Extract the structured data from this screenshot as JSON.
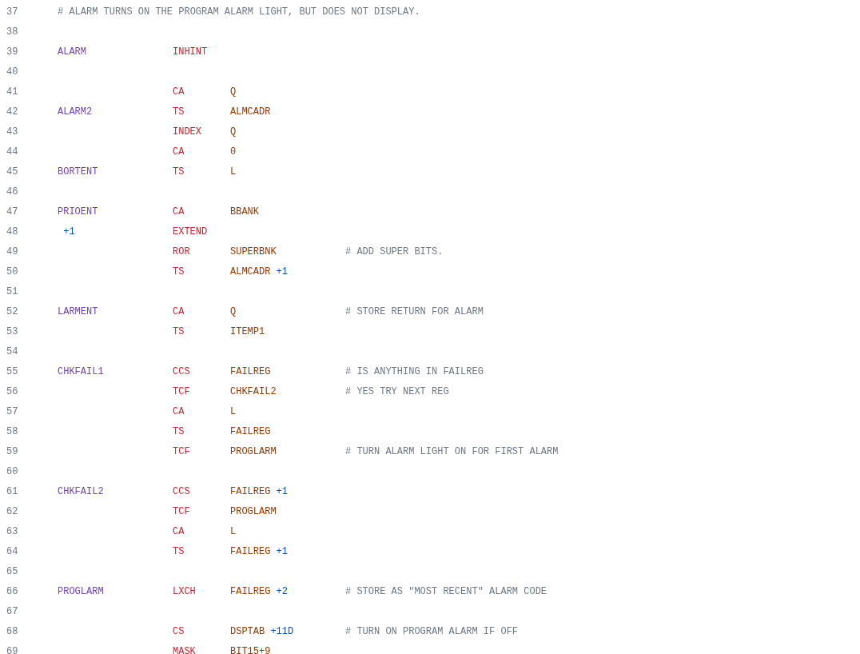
{
  "lines": [
    {
      "number": "37",
      "comment": "# ALARM TURNS ON THE PROGRAM ALARM LIGHT, BUT DOES NOT DISPLAY."
    },
    {
      "number": "38"
    },
    {
      "number": "39",
      "label": "ALARM",
      "opcode": "INHINT"
    },
    {
      "number": "40"
    },
    {
      "number": "41",
      "opcode": "CA",
      "operand": "Q"
    },
    {
      "number": "42",
      "label": "ALARM2",
      "opcode": "TS",
      "operand": "ALMCADR"
    },
    {
      "number": "43",
      "opcode": "INDEX",
      "operand": "Q"
    },
    {
      "number": "44",
      "opcode": "CA",
      "operand": "0"
    },
    {
      "number": "45",
      "label": "BORTENT",
      "opcode": "TS",
      "operand": "L"
    },
    {
      "number": "46"
    },
    {
      "number": "47",
      "label": "PRIOENT",
      "opcode": "CA",
      "operand": "BBANK"
    },
    {
      "number": "48",
      "label_offset": "+1",
      "opcode": "EXTEND"
    },
    {
      "number": "49",
      "opcode": "ROR",
      "operand": "SUPERBNK",
      "comment": "# ADD SUPER BITS."
    },
    {
      "number": "50",
      "opcode": "TS",
      "operand": "ALMCADR",
      "offset": "+1"
    },
    {
      "number": "51"
    },
    {
      "number": "52",
      "label": "LARMENT",
      "opcode": "CA",
      "operand": "Q",
      "comment": "# STORE RETURN FOR ALARM"
    },
    {
      "number": "53",
      "opcode": "TS",
      "operand": "ITEMP1"
    },
    {
      "number": "54"
    },
    {
      "number": "55",
      "label": "CHKFAIL1",
      "opcode": "CCS",
      "operand": "FAILREG",
      "comment": "# IS ANYTHING IN FAILREG"
    },
    {
      "number": "56",
      "opcode": "TCF",
      "operand": "CHKFAIL2",
      "comment": "# YES TRY NEXT REG"
    },
    {
      "number": "57",
      "opcode": "CA",
      "operand": "L"
    },
    {
      "number": "58",
      "opcode": "TS",
      "operand": "FAILREG"
    },
    {
      "number": "59",
      "opcode": "TCF",
      "operand": "PROGLARM",
      "comment": "# TURN ALARM LIGHT ON FOR FIRST ALARM"
    },
    {
      "number": "60"
    },
    {
      "number": "61",
      "label": "CHKFAIL2",
      "opcode": "CCS",
      "operand": "FAILREG",
      "offset": "+1"
    },
    {
      "number": "62",
      "opcode": "TCF",
      "operand": "PROGLARM"
    },
    {
      "number": "63",
      "opcode": "CA",
      "operand": "L"
    },
    {
      "number": "64",
      "opcode": "TS",
      "operand": "FAILREG",
      "offset": "+1"
    },
    {
      "number": "65"
    },
    {
      "number": "66",
      "label": "PROGLARM",
      "opcode": "LXCH",
      "operand": "FAILREG",
      "offset": "+2",
      "comment": "# STORE AS \"MOST RECENT\" ALARM CODE"
    },
    {
      "number": "67"
    },
    {
      "number": "68",
      "opcode": "CS",
      "operand": "DSPTAB",
      "offset": "+11D",
      "comment": "# TURN ON PROGRAM ALARM IF OFF"
    },
    {
      "number": "69",
      "opcode": "MASK",
      "operand": "BIT15+9"
    }
  ]
}
